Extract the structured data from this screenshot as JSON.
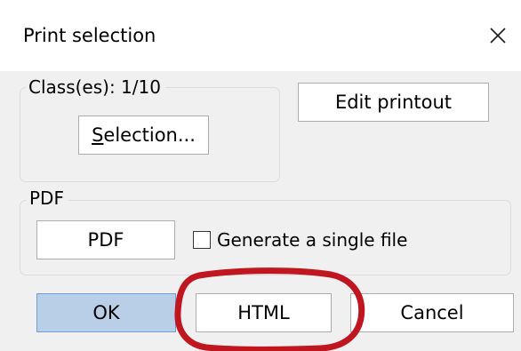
{
  "dialog": {
    "title": "Print selection",
    "close_icon": "close-icon"
  },
  "class_group": {
    "label": "Class(es): 1/10",
    "selection_button": {
      "mnemonic": "S",
      "rest": "election..."
    }
  },
  "edit_printout_label": "Edit printout",
  "pdf_group": {
    "label": "PDF",
    "pdf_button_label": "PDF",
    "single_file_checkbox": {
      "label": "Generate a single file",
      "checked": false
    }
  },
  "footer": {
    "ok_label": "OK",
    "html_label": "HTML",
    "cancel_label": "Cancel"
  },
  "annotation": {
    "highlight_target": "HTML",
    "color": "#c0161f"
  },
  "colors": {
    "dialog_bg": "#f0f0f0",
    "default_button_bg": "#b9cfe8",
    "default_button_border": "#6f9fd4"
  }
}
